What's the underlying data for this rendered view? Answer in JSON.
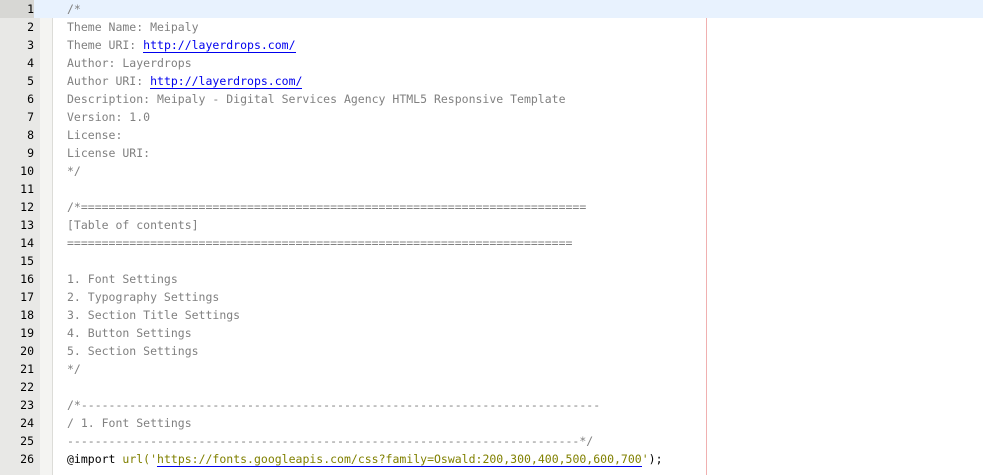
{
  "lines": [
    {
      "n": "1",
      "text": "/*"
    },
    {
      "n": "2",
      "text": "Theme Name: Meipaly"
    },
    {
      "n": "3",
      "pre": "Theme URI: ",
      "url": "http://layerdrops.com/"
    },
    {
      "n": "4",
      "text": "Author: Layerdrops"
    },
    {
      "n": "5",
      "pre": "Author URI: ",
      "url": "http://layerdrops.com/"
    },
    {
      "n": "6",
      "text": "Description: Meipaly - Digital Services Agency HTML5 Responsive Template"
    },
    {
      "n": "7",
      "text": "Version: 1.0"
    },
    {
      "n": "8",
      "text": "License:"
    },
    {
      "n": "9",
      "text": "License URI:"
    },
    {
      "n": "10",
      "text": "*/"
    },
    {
      "n": "11",
      "text": ""
    },
    {
      "n": "12",
      "text": "/*========================================================================="
    },
    {
      "n": "13",
      "text": "[Table of contents]"
    },
    {
      "n": "14",
      "text": "========================================================================="
    },
    {
      "n": "15",
      "text": ""
    },
    {
      "n": "16",
      "text": "1. Font Settings"
    },
    {
      "n": "17",
      "text": "2. Typography Settings"
    },
    {
      "n": "18",
      "text": "3. Section Title Settings"
    },
    {
      "n": "19",
      "text": "4. Button Settings"
    },
    {
      "n": "20",
      "text": "5. Section Settings"
    },
    {
      "n": "21",
      "text": "*/"
    },
    {
      "n": "22",
      "text": ""
    },
    {
      "n": "23",
      "text": "/*---------------------------------------------------------------------------"
    },
    {
      "n": "24",
      "text": "/ 1. Font Settings"
    },
    {
      "n": "25",
      "text": "--------------------------------------------------------------------------*/"
    },
    {
      "n": "26",
      "import": {
        "at": "@import",
        "fn": "url(",
        "quote_open": "'",
        "url": "https://fonts.googleapis.com/css?family=Oswald:200,300,400,500,600,700",
        "quote_close": "'",
        "close": ");"
      }
    }
  ]
}
